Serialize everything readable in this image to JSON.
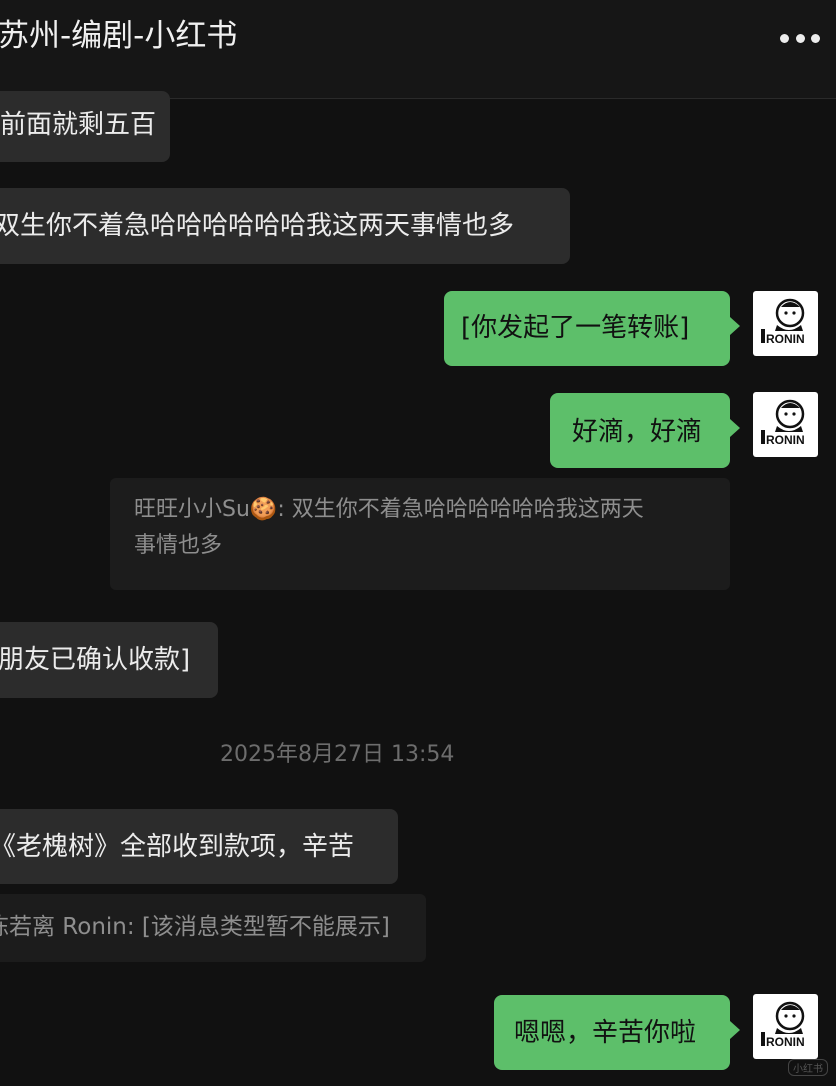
{
  "header": {
    "title": "苏州-编剧-小红书",
    "more_icon": "more-dots-icon"
  },
  "messages": {
    "m1": "前面就剩五百",
    "m2": "双生你不着急哈哈哈哈哈哈我这两天事情也多",
    "m3": "[你发起了一笔转账]",
    "m4": "好滴，好滴",
    "quote1_sender": "旺旺小小Su",
    "quote1_emoji": "🍪",
    "quote1_text": ": 双生你不着急哈哈哈哈哈哈我这两天",
    "quote1_text2": "事情也多",
    "m5": "朋友已确认收款]",
    "timestamp": "2025年8月27日 13:54",
    "m6": "《老槐树》全部收到款项，辛苦",
    "quote2": "陈若离 Ronin: [该消息类型暂不能展示]",
    "m7": "嗯嗯，辛苦你啦"
  },
  "avatar": {
    "label": "RONIN",
    "icon": "avatar-ronin-logo"
  },
  "colors": {
    "background": "#111111",
    "incoming_bubble": "#2c2c2c",
    "outgoing_bubble": "#5dbf6a",
    "quote_bg": "#1c1c1c"
  },
  "watermark": "小红书"
}
